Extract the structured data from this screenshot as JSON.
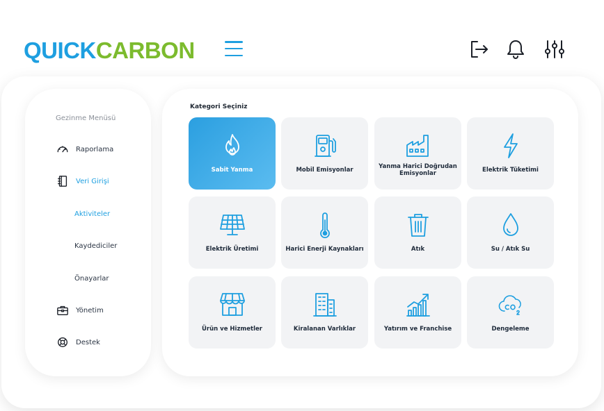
{
  "header": {
    "logo": {
      "part1": "QUICK",
      "part2": "CARBON"
    },
    "icons": [
      "menu-icon",
      "logout-icon",
      "bell-icon",
      "sliders-icon"
    ]
  },
  "sidebar": {
    "title": "Gezinme Menüsü",
    "items": [
      {
        "label": "Raporlama",
        "icon": "gauge-icon"
      },
      {
        "label": "Veri Girişi",
        "icon": "notebook-icon",
        "active": true
      },
      {
        "label": "Aktiviteler",
        "sub": true,
        "active": true
      },
      {
        "label": "Kaydediciler",
        "sub": true
      },
      {
        "label": "Önayarlar",
        "sub": true
      },
      {
        "label": "Yönetim",
        "icon": "briefcase-icon"
      },
      {
        "label": "Destek",
        "icon": "lifebuoy-icon"
      }
    ]
  },
  "main": {
    "title": "Kategori Seçiniz",
    "categories": [
      {
        "label": "Sabit Yanma",
        "icon": "flame-icon",
        "selected": true
      },
      {
        "label": "Mobil Emisyonlar",
        "icon": "fuel-pump-icon"
      },
      {
        "label": "Yanma Harici Doğrudan Emisyonlar",
        "icon": "factory-icon"
      },
      {
        "label": "Elektrik Tüketimi",
        "icon": "lightning-icon"
      },
      {
        "label": "Elektrik Üretimi",
        "icon": "solar-panel-icon"
      },
      {
        "label": "Harici Enerji Kaynakları",
        "icon": "thermometer-icon"
      },
      {
        "label": "Atık",
        "icon": "trash-icon"
      },
      {
        "label": "Su / Atık Su",
        "icon": "water-drop-icon"
      },
      {
        "label": "Ürün ve Hizmetler",
        "icon": "store-icon"
      },
      {
        "label": "Kiralanan Varlıklar",
        "icon": "building-icon"
      },
      {
        "label": "Yatırım ve Franchise",
        "icon": "growth-chart-icon"
      },
      {
        "label": "Dengeleme",
        "icon": "co2-cloud-icon"
      }
    ]
  },
  "colors": {
    "accent": "#1e9fe0",
    "brand_green": "#7cbb2e",
    "card_bg": "#f2f3f5",
    "selected_card": "#3aa8e8"
  }
}
